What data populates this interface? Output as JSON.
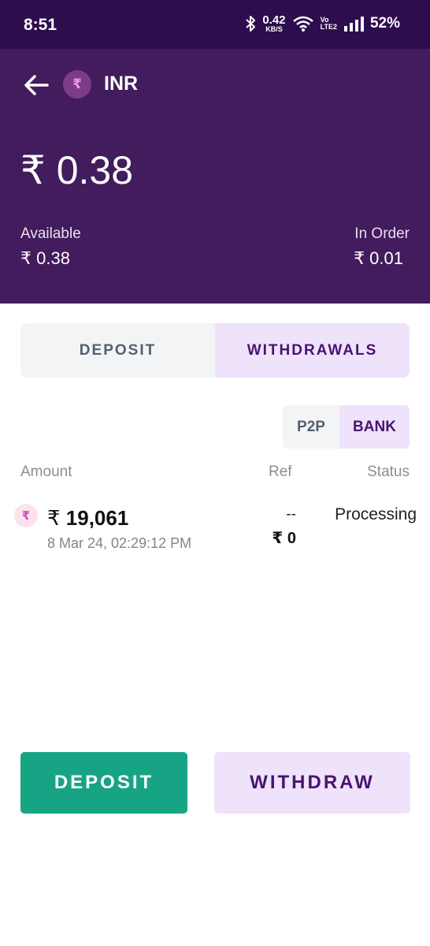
{
  "status_bar": {
    "time": "8:51",
    "net_speed_value": "0.42",
    "net_speed_unit": "KB/S",
    "volte_top": "Vo",
    "volte_bottom": "LTE2",
    "battery": "52%"
  },
  "header": {
    "currency_symbol": "₹",
    "title": "INR",
    "balance": "₹ 0.38",
    "available_label": "Available",
    "available_value": "₹ 0.38",
    "in_order_label": "In Order",
    "in_order_value": "₹ 0.01"
  },
  "tabs": [
    {
      "label": "DEPOSIT",
      "selected": false
    },
    {
      "label": "WITHDRAWALS",
      "selected": true
    }
  ],
  "segment": [
    {
      "label": "P2P",
      "selected": false
    },
    {
      "label": "BANK",
      "selected": true
    }
  ],
  "columns": {
    "amount": "Amount",
    "ref": "Ref",
    "status": "Status"
  },
  "transactions": [
    {
      "coin_symbol": "₹",
      "currency": "₹",
      "amount": "19,061",
      "date": "8 Mar 24, 02:29:12 PM",
      "ref": "--",
      "ref_amount": "₹ 0",
      "status": "Processing"
    }
  ],
  "actions": {
    "deposit": "DEPOSIT",
    "withdraw": "WITHDRAW"
  },
  "colors": {
    "header_bg": "#421c5d",
    "status_bar_bg": "#2e0d4e",
    "deposit_green": "#17a484",
    "withdraw_lilac": "#efe2fb",
    "accent_purple": "#4a1370"
  }
}
